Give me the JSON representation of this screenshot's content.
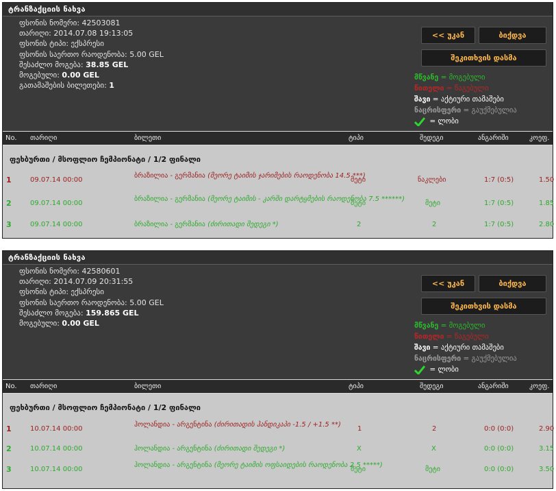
{
  "labels": {
    "panel_title": "ტრანზაქციის ნახვა",
    "ticket_number": "ფსონის ნომერი:",
    "date": "თარიღი:",
    "bet_type": "ფსონის ტიპი:",
    "total_coefficient": "ფსონის საერთო რაოდენობა:",
    "possible_win": "შესაძლო მოგება:",
    "won": "მოგებული:",
    "paid_tickets": "გათამაშების ბილეთები:",
    "back": "<< უკან",
    "forward": "ბიქდვა",
    "print": "შეკითხვის დასმა"
  },
  "legend": [
    {
      "word": "მწვანე",
      "text": " = მოგებული",
      "color": "green"
    },
    {
      "word": "წითელი",
      "text": " = წაგებული",
      "color": "red"
    },
    {
      "word": "შავი",
      "text": " = აქტიური თამაშები",
      "color": "white"
    },
    {
      "word": "ნაცრისფერი",
      "text": " = გაუქმებულია",
      "color": "gray"
    },
    {
      "word": "",
      "text": " = ლობი",
      "color": "white",
      "icon": "checkmark-icon"
    }
  ],
  "columns": [
    "No.",
    "თარიღი",
    "ბილეთი",
    "ტიპი",
    "შედეგი",
    "ანგარიში",
    "კოეფ."
  ],
  "transactions": [
    {
      "ticket_number": "42503081",
      "date": "2014.07.08 19:13:05",
      "bet_type": "ექსპრესი",
      "total_amount": "5.00 GEL",
      "possible_win": "38.85 GEL",
      "won": "0.00 GEL",
      "paid_tickets": "1",
      "section": "ფეხბურთი / მსოფლიო ჩემპიონატი / 1/2 ფინალი",
      "rows": [
        {
          "no": "1",
          "date": "09.07.14 00:00",
          "match": "ბრაზილია - გერმანია",
          "detail": " (მეორე ტაიმის ჯარიმების რაოდენობა 14.5 ***)",
          "type": "მეტი",
          "result": "ნაკლები",
          "score": "1:7 (0:5)",
          "coef": "1.50",
          "color": "red"
        },
        {
          "no": "2",
          "date": "09.07.14 00:00",
          "match": "ბრაზილია - გერმანია",
          "detail": " (მეორე ტაიმის - კარში დარტყმების რაოდენობა 7.5 ******)",
          "type": "მეტი",
          "result": "მეტი",
          "score": "1:7 (0:5)",
          "coef": "1.85",
          "color": "green"
        },
        {
          "no": "3",
          "date": "09.07.14 00:00",
          "match": "ბრაზილია - გერმანია",
          "detail": " (ძირითადი შედეგი *)",
          "type": "2",
          "result": "2",
          "score": "1:7 (0:5)",
          "coef": "2.80",
          "color": "green"
        }
      ]
    },
    {
      "ticket_number": "42580601",
      "date": "2014.07.09 20:31:55",
      "bet_type": "ექსპრესი",
      "total_amount": "5.00 GEL",
      "possible_win": "159.865 GEL",
      "won": "0.00 GEL",
      "paid_tickets": "",
      "section": "ფეხბურთი / მსოფლიო ჩემპიონატი / 1/2 ფინალი",
      "rows": [
        {
          "no": "1",
          "date": "10.07.14 00:00",
          "match": "ჰოლანდია - არგენტინა",
          "detail": " (ძირითადის ჰანდიკაპი -1.5 / +1.5 **)",
          "type": "1",
          "result": "2",
          "score": "0:0 (0:0)",
          "coef": "2.90",
          "color": "red"
        },
        {
          "no": "2",
          "date": "10.07.14 00:00",
          "match": "ჰოლანდია - არგენტინა",
          "detail": " (ძირითადი შედეგი *)",
          "type": "X",
          "result": "X",
          "score": "0:0 (0:0)",
          "coef": "3.15",
          "color": "green"
        },
        {
          "no": "3",
          "date": "10.07.14 00:00",
          "match": "ჰოლანდია - არგენტინა",
          "detail": " (მეორე ტაიმის ოფსაიდების რაოდენობა 2.5 *****)",
          "type": "მეტი",
          "result": "მეტი",
          "score": "0:0 (0:0)",
          "coef": "3.50",
          "color": "green"
        }
      ]
    }
  ]
}
